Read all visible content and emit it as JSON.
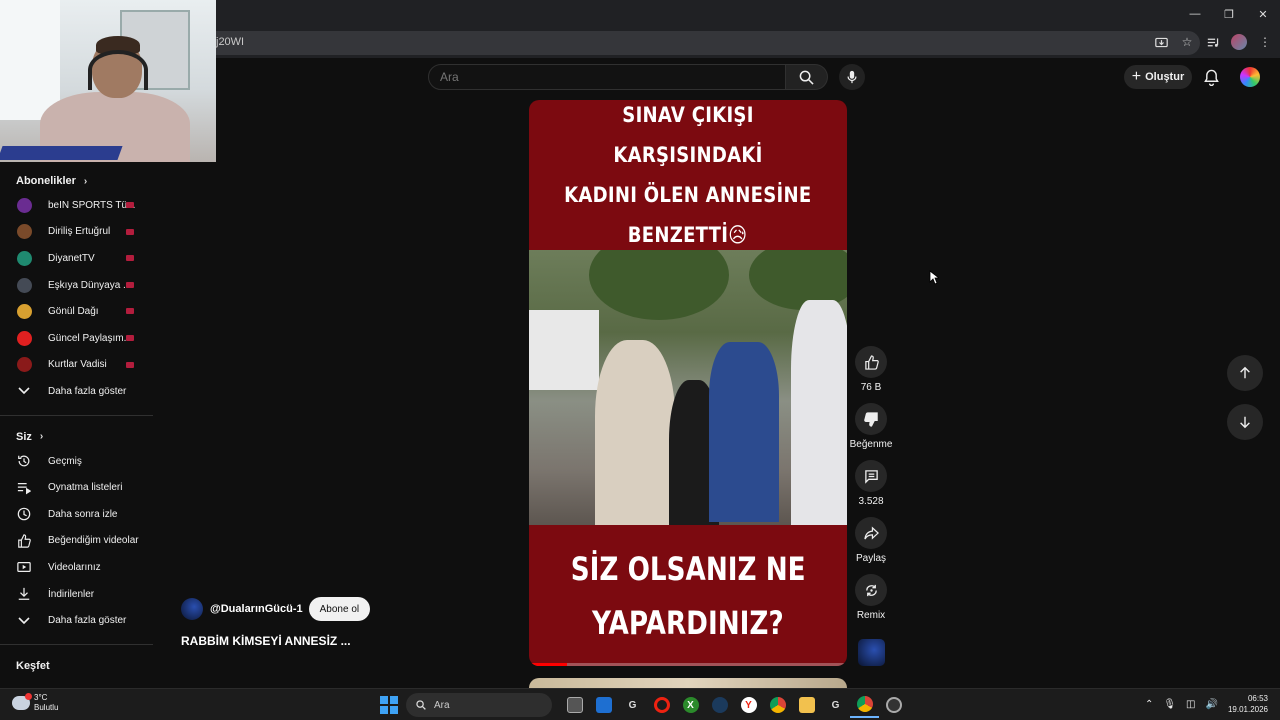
{
  "browser": {
    "url_fragment": "j20WI",
    "window_controls": [
      "minimize-icon",
      "restore-icon",
      "close-icon"
    ],
    "address_icons": [
      "install-icon",
      "star-icon",
      "media-icon",
      "profile-icon",
      "menu-icon"
    ]
  },
  "header": {
    "search_placeholder": "Ara",
    "create_label": "Oluştur"
  },
  "sidebar": {
    "subscriptions_title": "Abonelikler",
    "subscriptions": [
      {
        "label": "beIN SPORTS Tü...",
        "color": "#6a2c91"
      },
      {
        "label": "Diriliş Ertuğrul",
        "color": "#7a4a2a"
      },
      {
        "label": "DiyanetTV",
        "color": "#1f8a70"
      },
      {
        "label": "Eşkıya Dünyaya ...",
        "color": "#444a55"
      },
      {
        "label": "Gönül Dağı",
        "color": "#d8a030"
      },
      {
        "label": "Güncel Paylaşım...",
        "color": "#e02020"
      },
      {
        "label": "Kurtlar Vadisi",
        "color": "#8a1a1a"
      }
    ],
    "subscriptions_more": "Daha fazla göster",
    "you_title": "Siz",
    "you_items": [
      {
        "label": "Geçmiş",
        "icon": "history-icon"
      },
      {
        "label": "Oynatma listeleri",
        "icon": "playlist-icon"
      },
      {
        "label": "Daha sonra izle",
        "icon": "clock-icon"
      },
      {
        "label": "Beğendiğim videolar",
        "icon": "thumbs-up-icon"
      },
      {
        "label": "Videolarınız",
        "icon": "video-icon"
      },
      {
        "label": "İndirilenler",
        "icon": "download-icon"
      }
    ],
    "you_more": "Daha fazla göster",
    "explore_title": "Keşfet"
  },
  "short": {
    "headline_lines": [
      "SINAV ÇIKIŞI KARŞISINDAKİ",
      "KADINI ÖLEN ANNESİNE",
      "BENZETTİ😥"
    ],
    "question_lines": [
      "SİZ OLSANIZ NE",
      "YAPARDINIZ?"
    ],
    "progress": 0.12,
    "channel": "@DualarınGücü-1",
    "subscribe_label": "Abone ol",
    "title": "RABBİM KİMSEYİ ANNESİZ ..."
  },
  "actions": {
    "likes": "76 B",
    "dislike_label": "Beğenme",
    "comments": "3.528",
    "share_label": "Paylaş",
    "remix_label": "Remix"
  },
  "taskbar": {
    "weather_temp": "3°C",
    "weather_desc": "Bulutlu",
    "search_label": "Ara",
    "time": "06:53",
    "date": "19.01.2026"
  }
}
